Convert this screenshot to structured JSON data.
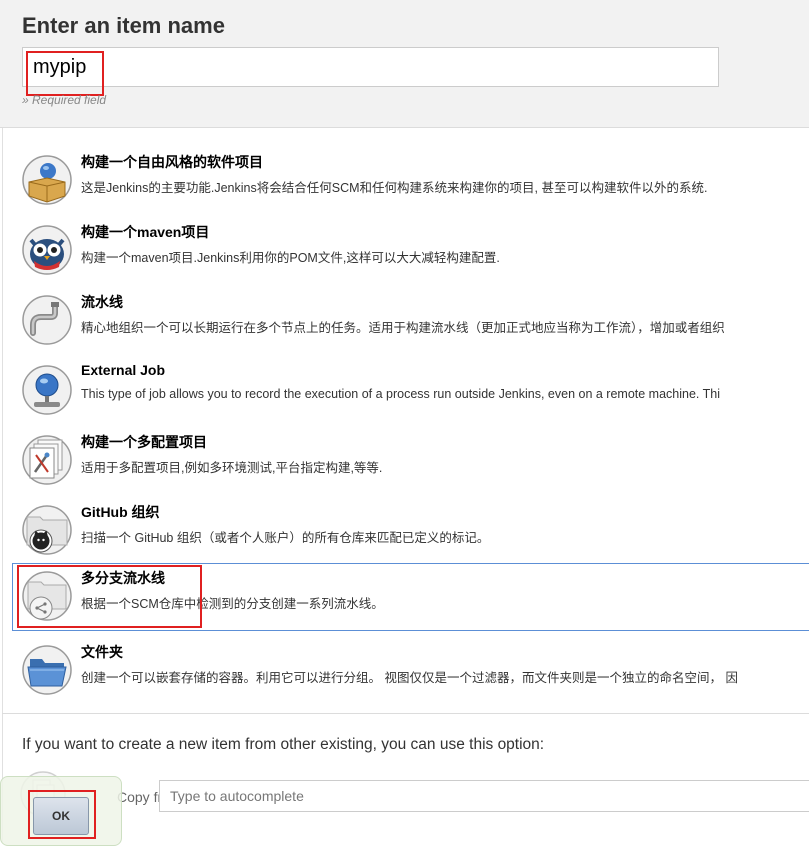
{
  "header": {
    "title": "Enter an item name",
    "name_value": "mypip",
    "required_note": "» Required field"
  },
  "items": [
    {
      "title": "构建一个自由风格的软件项目",
      "desc": "这是Jenkins的主要功能.Jenkins将会结合任何SCM和任何构建系统来构建你的项目, 甚至可以构建软件以外的系统.",
      "icon": "freestyle-box-icon"
    },
    {
      "title": "构建一个maven项目",
      "desc": "构建一个maven项目.Jenkins利用你的POM文件,这样可以大大减轻构建配置.",
      "icon": "maven-owl-icon"
    },
    {
      "title": "流水线",
      "desc": "精心地组织一个可以长期运行在多个节点上的任务。适用于构建流水线（更加正式地应当称为工作流），增加或者组织",
      "icon": "pipeline-icon"
    },
    {
      "title": "External Job",
      "desc": "This type of job allows you to record the execution of a process run outside Jenkins, even on a remote machine. Thi",
      "icon": "external-job-icon"
    },
    {
      "title": "构建一个多配置项目",
      "desc": "适用于多配置项目,例如多环境测试,平台指定构建,等等.",
      "icon": "multi-config-icon"
    },
    {
      "title": "GitHub 组织",
      "desc": "扫描一个 GitHub 组织（或者个人账户）的所有仓库来匹配已定义的标记。",
      "icon": "github-organization-icon"
    },
    {
      "title": "多分支流水线",
      "desc": "根据一个SCM仓库中检测到的分支创建一系列流水线。",
      "icon": "multibranch-pipeline-icon",
      "selected": true
    },
    {
      "title": "文件夹",
      "desc": "创建一个可以嵌套存储的容器。利用它可以进行分组。 视图仅仅是一个过滤器，而文件夹则是一个独立的命名空间， 因",
      "icon": "folder-icon"
    }
  ],
  "copy": {
    "label": "If you want to create a new item from other existing, you can use this option:",
    "from_label": "Copy from",
    "placeholder": "Type to autocomplete"
  },
  "ok_label": "OK"
}
